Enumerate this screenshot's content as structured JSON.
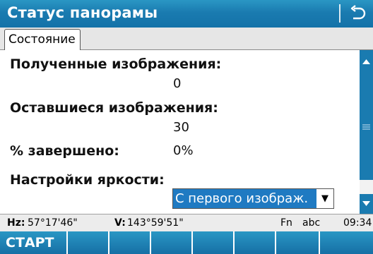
{
  "titlebar": {
    "title": "Статус панорамы",
    "back_icon": "return-arrow-icon"
  },
  "tabs": [
    {
      "label": "Состояние",
      "active": true
    }
  ],
  "fields": {
    "received_label": "Полученные изображения:",
    "received_value": "0",
    "remaining_label": "Оставшиеся изображения:",
    "remaining_value": "30",
    "complete_label": "% завершено:",
    "complete_value": "0%",
    "brightness_label": "Настройки яркости:",
    "brightness_value": "С первого изображ."
  },
  "statusbar": {
    "hz_label": "Hz:",
    "hz_value": "57°17'46\"",
    "v_label": "V:",
    "v_value": "143°59'51\"",
    "fn": "Fn",
    "input_mode": "abc",
    "time": "09:34"
  },
  "softkeys": [
    "СТАРТ",
    "",
    "",
    "",
    "",
    "",
    ""
  ],
  "colors": {
    "accent": "#1a7bb0",
    "selection": "#1f7ac2",
    "tab_background": "#e6e6e6"
  }
}
